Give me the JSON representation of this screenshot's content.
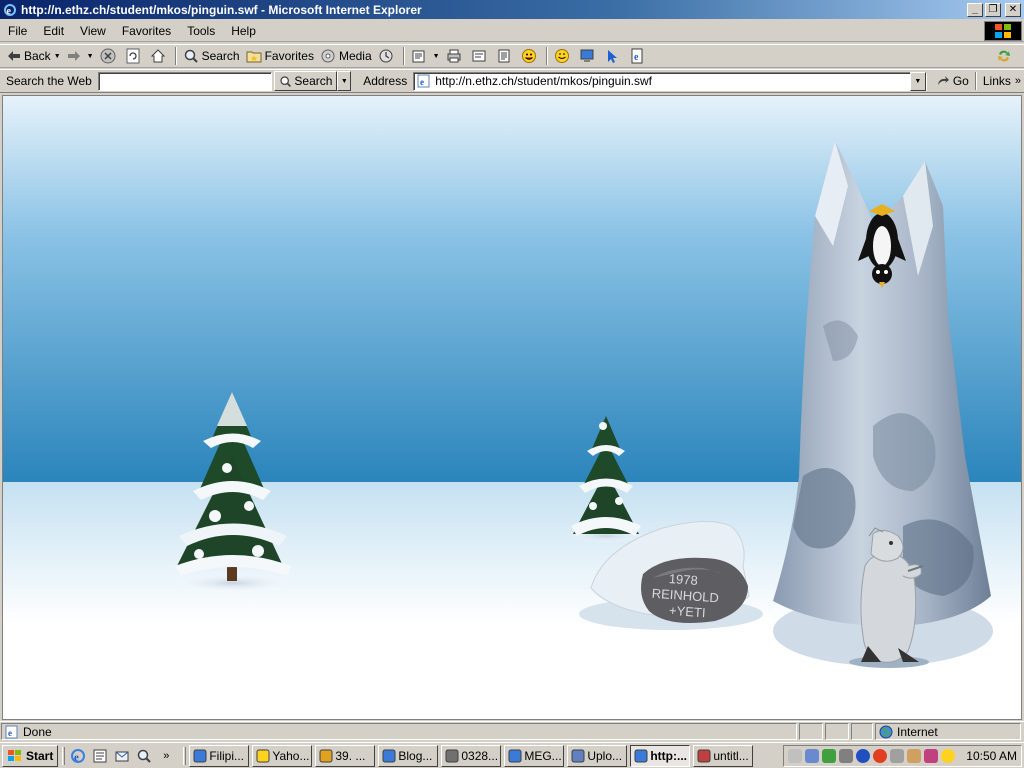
{
  "window": {
    "title": "http://n.ethz.ch/student/mkos/pinguin.swf - Microsoft Internet Explorer"
  },
  "menu": {
    "items": [
      "File",
      "Edit",
      "View",
      "Favorites",
      "Tools",
      "Help"
    ]
  },
  "toolbar": {
    "back": "Back",
    "search": "Search",
    "favorites": "Favorites",
    "media": "Media"
  },
  "addressbar": {
    "search_web_label": "Search the Web",
    "search_value": "",
    "search_button": "Search",
    "address_label": "Address",
    "url": "http://n.ethz.ch/student/mkos/pinguin.swf",
    "go_label": "Go",
    "links_label": "Links"
  },
  "flash": {
    "rock_inscription": [
      "1978",
      "REINHOLD",
      "+YETI"
    ]
  },
  "status": {
    "text": "Done",
    "zone": "Internet"
  },
  "taskbar": {
    "start": "Start",
    "tasks": [
      "Filipi...",
      "Yaho...",
      "39. ...",
      "Blog...",
      "0328...",
      "MEG...",
      "Uplo...",
      "http:...",
      "untitl..."
    ],
    "active_task_index": 7,
    "clock": "10:50 AM"
  },
  "colors": {
    "titlebar": "#0a246a",
    "sky": "#2f87bd",
    "snow": "#ffffff"
  }
}
